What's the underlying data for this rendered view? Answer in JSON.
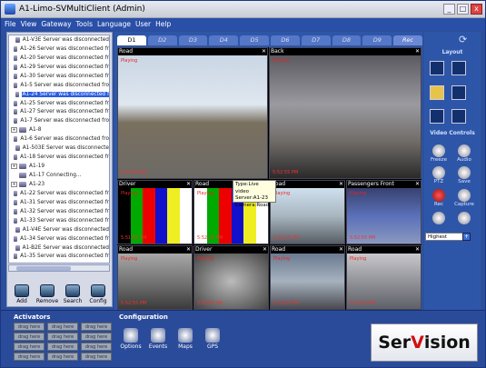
{
  "window": {
    "title": "A1-Limo-SVMultiClient (Admin)",
    "min": "_",
    "max": "□",
    "close": "x"
  },
  "menu": [
    "File",
    "View",
    "Gateway",
    "Tools",
    "Language",
    "User",
    "Help"
  ],
  "tree": [
    {
      "label": "A1-V3E Server was disconnected",
      "expand": ""
    },
    {
      "label": "A1-26 Server was disconnected fr",
      "expand": ""
    },
    {
      "label": "A1-20 Server was disconnected fr",
      "expand": ""
    },
    {
      "label": "A1-29 Server was disconnected fr",
      "expand": ""
    },
    {
      "label": "A1-30 Server was disconnected fr",
      "expand": ""
    },
    {
      "label": "A1-5 Server was disconnected fro",
      "expand": ""
    },
    {
      "label": "A1-24 Server was disconnected f",
      "expand": "",
      "selected": true
    },
    {
      "label": "A1-25 Server was disconnected fr",
      "expand": ""
    },
    {
      "label": "A1-27 Server was disconnected fr",
      "expand": ""
    },
    {
      "label": "A1-7 Server was disconnected fro",
      "expand": ""
    },
    {
      "label": "A1-8",
      "expand": "+"
    },
    {
      "label": "A1-6 Server was disconnected fro",
      "expand": ""
    },
    {
      "label": "A1-503E Server was disconnecte",
      "expand": ""
    },
    {
      "label": "A1-18 Server was disconnected fr",
      "expand": ""
    },
    {
      "label": "A1-19",
      "expand": "+"
    },
    {
      "label": "A1-17 Connecting...",
      "expand": ""
    },
    {
      "label": "A1-23",
      "expand": "+"
    },
    {
      "label": "A1-22 Server was disconnected fr",
      "expand": ""
    },
    {
      "label": "A1-31 Server was disconnected fr",
      "expand": ""
    },
    {
      "label": "A1-32 Server was disconnected fr",
      "expand": ""
    },
    {
      "label": "A1-33 Server was disconnected fr",
      "expand": ""
    },
    {
      "label": "A1-V4E Server was disconnected",
      "expand": ""
    },
    {
      "label": "A1-34 Server was disconnected fr",
      "expand": ""
    },
    {
      "label": "A1-B2E Server was disconnected",
      "expand": ""
    },
    {
      "label": "A1-35 Server was disconnected fr",
      "expand": ""
    },
    {
      "label": "A1-28 Server was disconnected fr",
      "expand": ""
    },
    {
      "label": "A1-505E Server was disconnecte",
      "expand": ""
    },
    {
      "label": "A1-508E Server was disconnecte",
      "expand": ""
    },
    {
      "label": "A1-15 Connecting...",
      "expand": ""
    }
  ],
  "tree_buttons": [
    "Add",
    "Remove",
    "Search",
    "Config"
  ],
  "tabs": [
    "D1",
    "D2",
    "D3",
    "D4",
    "D5",
    "D6",
    "D7",
    "D8",
    "D9",
    "Rec"
  ],
  "tiles": [
    {
      "title": "Road",
      "status": "Playing",
      "time": "5:52:55 PM"
    },
    {
      "title": "Back",
      "status": "Playing",
      "time": "5:52:55 PM"
    },
    {
      "title": "Driver",
      "status": "Playing",
      "time": "5:51:55 PM"
    },
    {
      "title": "Road",
      "status": "Playing",
      "time": "5:52:22 PM"
    },
    {
      "title": "Road",
      "status": "Playing",
      "time": "5:52:55 PM"
    },
    {
      "title": "Passengers Front",
      "status": "Playing",
      "time": "5:52:55 PM"
    },
    {
      "title": "Road",
      "status": "Playing",
      "time": "5:52:55 PM"
    },
    {
      "title": "Driver",
      "status": "Playing",
      "time": "5:52:55 PM"
    },
    {
      "title": "Road",
      "status": "Playing",
      "time": "5:52:55 PM"
    },
    {
      "title": "Road",
      "status": "Playing",
      "time": "5:52:55 PM"
    }
  ],
  "tooltip": {
    "type": "Type:Live video",
    "server": "Server:A1-23",
    "camera": "Camera:Road"
  },
  "right": {
    "layout_title": "Layout",
    "video_controls_title": "Video Controls",
    "controls": [
      "Freeze",
      "Audio",
      "PTZ",
      "Save",
      "Rec",
      "Capture"
    ],
    "quality": "Highest",
    "refresh": "⟳"
  },
  "bottom": {
    "activators_title": "Activators",
    "activator_label": "drag here",
    "configuration_title": "Configuration",
    "config_items": [
      "Options",
      "Events",
      "Maps",
      "GPS"
    ],
    "logo_a": "Ser",
    "logo_b": "V",
    "logo_c": "ision"
  },
  "colors": {
    "accent": "#2c4f9c",
    "playing": "#e22222",
    "logo_red": "#d01010"
  }
}
